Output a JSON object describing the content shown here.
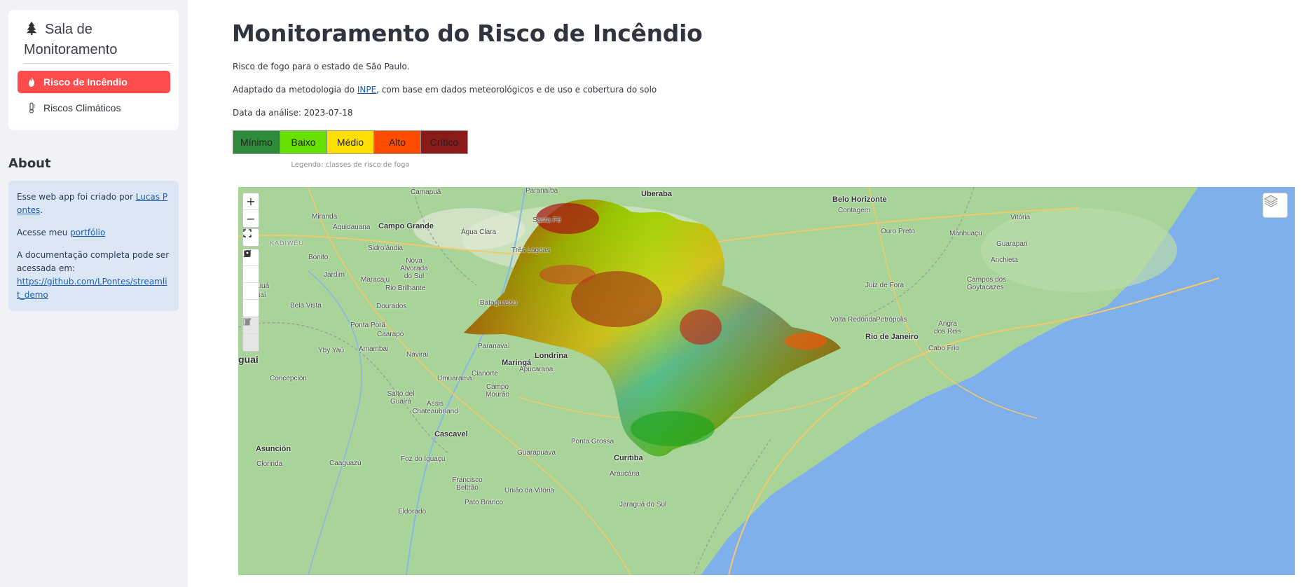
{
  "sidebar": {
    "nav_title": "Sala de Monitoramento",
    "items": [
      {
        "label": "Risco de Incêndio",
        "icon": "flame-icon",
        "active": true
      },
      {
        "label": "Riscos Climáticos",
        "icon": "thermometer-icon",
        "active": false
      }
    ],
    "about_title": "About",
    "about": {
      "line1_prefix": "Esse web app foi criado por ",
      "line1_link": "Lucas Pontes",
      "line1_suffix": ".",
      "line2_prefix": "Acesse meu ",
      "line2_link": "portfólio",
      "line3_text": "A documentação completa pode ser acessada em:",
      "line3_link": "https://github.com/LPontes/streamlit_demo"
    }
  },
  "main": {
    "title": "Monitoramento do Risco de Incêndio",
    "subtitle": "Risco de fogo para o estado de São Paulo.",
    "method_prefix": "Adaptado da metodologia do ",
    "method_link": "INPE",
    "method_suffix": ", com base em dados meteorológicos e de uso e cobertura do solo",
    "analysis_date": "Data da análise: 2023-07-18",
    "legend": [
      {
        "label": "Mínimo",
        "color": "#2e8b3a"
      },
      {
        "label": "Baixo",
        "color": "#66e000"
      },
      {
        "label": "Médio",
        "color": "#ffe000"
      },
      {
        "label": "Alto",
        "color": "#ff4d00"
      },
      {
        "label": "Crítico",
        "color": "#8b1a1a"
      }
    ],
    "legend_caption": "Legenda: classes de risco de fogo"
  },
  "map": {
    "zoom_in": "+",
    "zoom_out": "−",
    "controls": [
      "fullscreen-icon",
      "polyline-icon",
      "polygon-icon",
      "rectangle-icon",
      "marker-icon",
      "edit-icon",
      "trash-icon"
    ],
    "cities": [
      {
        "name": "Uberaba"
      },
      {
        "name": "Belo Horizonte"
      },
      {
        "name": "Contagem"
      },
      {
        "name": "Campo Grande"
      },
      {
        "name": "Rio de Janeiro"
      },
      {
        "name": "Curitiba"
      },
      {
        "name": "Asunción"
      },
      {
        "name": "Londrina"
      },
      {
        "name": "Maringá"
      },
      {
        "name": "Cascavel"
      },
      {
        "name": "Juiz de Fora"
      },
      {
        "name": "Campos dos Goytacazes"
      },
      {
        "name": "Vitória"
      },
      {
        "name": "Volta Redonda"
      },
      {
        "name": "Petrópolis"
      },
      {
        "name": "Ponta Grossa"
      },
      {
        "name": "Dourados"
      },
      {
        "name": "Miranda"
      },
      {
        "name": "Aquidauana"
      },
      {
        "name": "Bonito"
      },
      {
        "name": "Jardim"
      },
      {
        "name": "Maracaju"
      },
      {
        "name": "Sidrolândia"
      },
      {
        "name": "Nova Alvorada do Sul"
      },
      {
        "name": "Rio Brilhante"
      },
      {
        "name": "Bela Vista"
      },
      {
        "name": "Ponta Porã"
      },
      {
        "name": "Caarapó"
      },
      {
        "name": "Amambai"
      },
      {
        "name": "Navirai"
      },
      {
        "name": "Paranavaí"
      },
      {
        "name": "Umuarama"
      },
      {
        "name": "Cianorte"
      },
      {
        "name": "Apucarana"
      },
      {
        "name": "Campo Mourão"
      },
      {
        "name": "Assis Chateaubriand"
      },
      {
        "name": "Salto del Guairá"
      },
      {
        "name": "Guarapuava"
      },
      {
        "name": "Foz do Iguaçu"
      },
      {
        "name": "Francisco Beltrão"
      },
      {
        "name": "União da Vitória"
      },
      {
        "name": "Pato Branco"
      },
      {
        "name": "Araucária"
      },
      {
        "name": "Jaraguá do Sul"
      },
      {
        "name": "Camapuã"
      },
      {
        "name": "Paranaíba"
      },
      {
        "name": "Água Clara"
      },
      {
        "name": "Três Lagoas"
      },
      {
        "name": "Santa Fé"
      },
      {
        "name": "Bataguassu"
      },
      {
        "name": "Ouro Preto"
      },
      {
        "name": "Manhuaçu"
      },
      {
        "name": "Guarapari"
      },
      {
        "name": "Anchieta"
      },
      {
        "name": "Angra dos Reis"
      },
      {
        "name": "Cabo Frio"
      },
      {
        "name": "Concepción"
      },
      {
        "name": "Yby Yaú"
      },
      {
        "name": "Caaguazú"
      },
      {
        "name": "Clorinda"
      },
      {
        "name": "Eldorado"
      },
      {
        "name": "Caiuá"
      },
      {
        "name": "Guaí"
      }
    ],
    "country_label": "KADIWÉU",
    "side_label": "guai"
  }
}
